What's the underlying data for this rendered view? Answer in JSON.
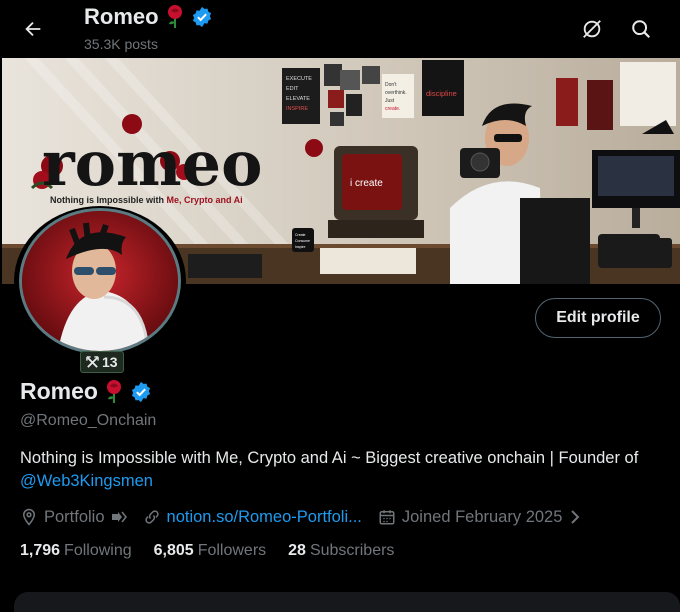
{
  "header": {
    "display_name": "Romeo",
    "posts_count": "35.3K posts"
  },
  "banner": {
    "logo_text": "romeo",
    "tagline_prefix": "Nothing is Impossible with ",
    "tagline_highlight": "Me, Crypto and Ai",
    "sticky_lines": [
      "EXECUTE",
      "EDIT",
      "ELEVATE",
      "INSPIRE"
    ],
    "note_text": [
      "Don't",
      "overthink.",
      "Just",
      "create."
    ],
    "poster_text": "discipline",
    "tv_text": "i create",
    "mug_text": [
      "Create",
      "Consume",
      "Inspire"
    ]
  },
  "avatar_badge": {
    "count": "13"
  },
  "profile": {
    "name": "Romeo",
    "handle": "@Romeo_Onchain",
    "bio_text": "Nothing is Impossible with Me, Crypto and Ai  ~ Biggest creative onchain | Founder of ",
    "bio_mention": "@Web3Kingsmen",
    "edit_label": "Edit profile"
  },
  "meta": {
    "category": "Portfolio",
    "link": "notion.so/Romeo-Portfoli...",
    "joined": "Joined February 2025"
  },
  "stats": {
    "following_count": "1,796",
    "following_label": "Following",
    "followers_count": "6,805",
    "followers_label": "Followers",
    "subscribers_count": "28",
    "subscribers_label": "Subscribers"
  },
  "colors": {
    "accent": "#1d9bf0",
    "verified": "#1d9bf0",
    "muted": "#71767b",
    "rose": "#c8102e"
  },
  "icons": [
    "back-arrow-icon",
    "rose-icon",
    "verified-badge-icon",
    "refresh-icon",
    "search-icon",
    "cross-arrows-icon",
    "location-icon",
    "link-icon",
    "calendar-icon",
    "chevron-right-icon",
    "affiliate-arrow-icon"
  ]
}
